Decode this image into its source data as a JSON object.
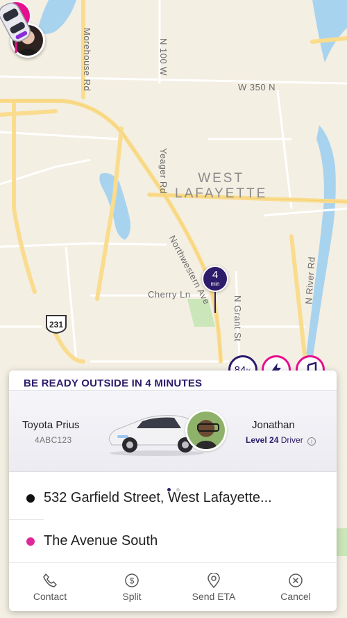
{
  "map": {
    "streets": {
      "morehouse": "Morehouse Rd",
      "n100w": "N 100 W",
      "w350n": "W 350 N",
      "yeager": "Yeager Rd",
      "northwestern": "Northwestern Ave",
      "cherry": "Cherry Ln",
      "ngrant": "N Grant St",
      "nriver": "N River Rd"
    },
    "city_line1": "WEST",
    "city_line2": "LAFAYETTE",
    "highway_shield": "231",
    "eta": {
      "value": "4",
      "unit": "min"
    }
  },
  "status_chips": {
    "percent_value": "84",
    "percent_sign": "%",
    "bolt_icon": "bolt-icon",
    "music_icon": "music-note-icon"
  },
  "ride_card": {
    "headline": "BE READY OUTSIDE IN 4 MINUTES",
    "vehicle": {
      "model": "Toyota Prius",
      "plate": "4ABC123"
    },
    "driver": {
      "name": "Jonathan",
      "level_prefix": "Level 24",
      "level_suffix": "Driver"
    },
    "pager": {
      "count": 2,
      "active": 0
    },
    "pickup": {
      "address": "532 Garfield Street, West Lafayette..."
    },
    "dropoff": {
      "address": "The Avenue South"
    },
    "actions": [
      {
        "label": "Contact",
        "icon": "phone-icon"
      },
      {
        "label": "Split",
        "icon": "dollar-icon"
      },
      {
        "label": "Send ETA",
        "icon": "location-pin-icon"
      },
      {
        "label": "Cancel",
        "icon": "close-circle-icon"
      }
    ]
  },
  "colors": {
    "brand_pink": "#e60f8e",
    "brand_purple": "#2d1b6b",
    "map_bg": "#f4efe3",
    "road_yellow": "#f9dc8e",
    "water": "#a8d3ef"
  }
}
